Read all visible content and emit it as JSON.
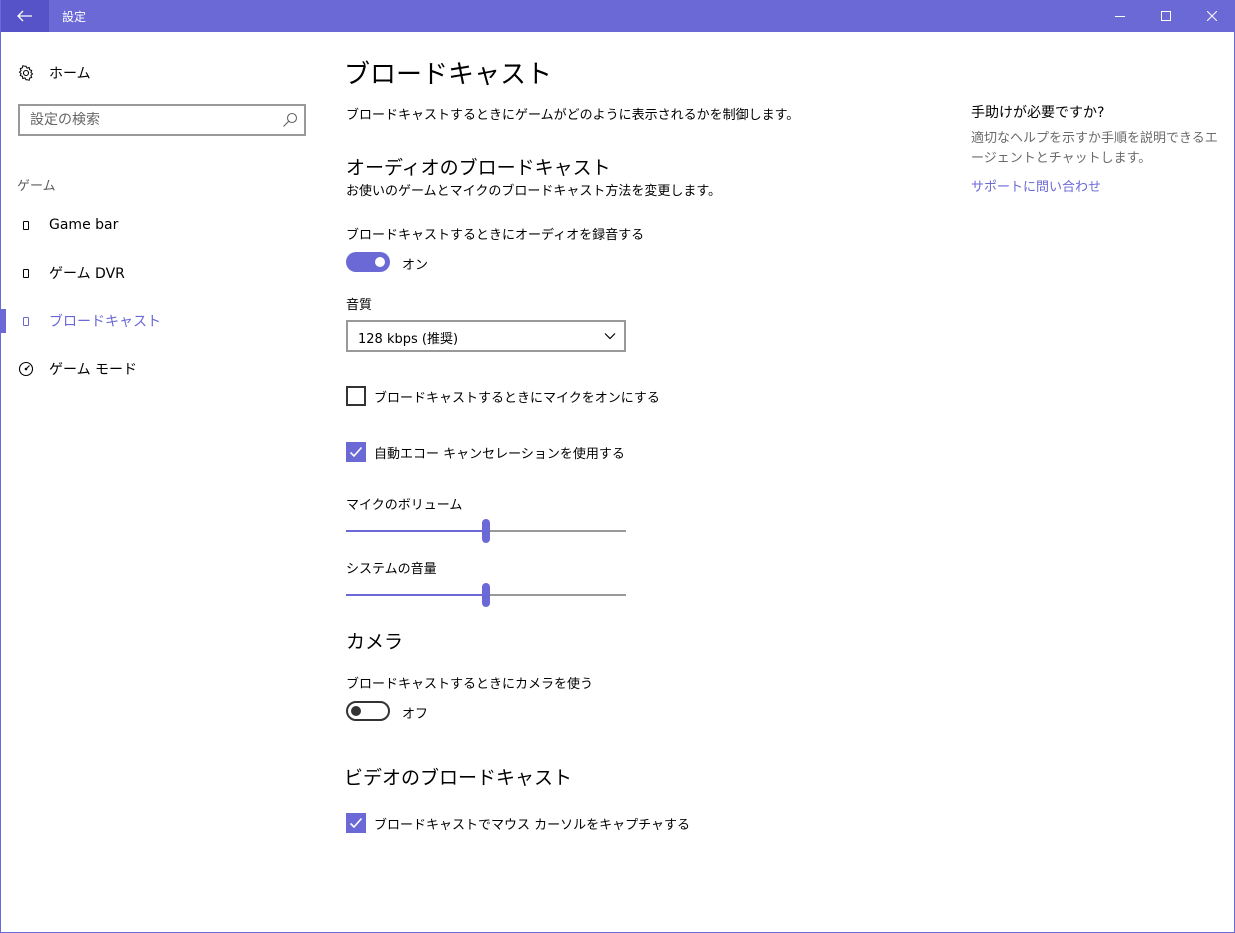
{
  "window": {
    "title": "設定",
    "accent_color": "#6b69d6"
  },
  "sidebar": {
    "home_label": "ホーム",
    "search_placeholder": "設定の検索",
    "group_header": "ゲーム",
    "items": [
      {
        "label": "Game bar",
        "selected": false
      },
      {
        "label": "ゲーム DVR",
        "selected": false
      },
      {
        "label": "ブロードキャスト",
        "selected": true
      },
      {
        "label": "ゲーム モード",
        "selected": false
      }
    ]
  },
  "main": {
    "page_title": "ブロードキャスト",
    "page_desc": "ブロードキャストするときにゲームがどのように表示されるかを制御します。",
    "audio": {
      "title": "オーディオのブロードキャスト",
      "desc": "お使いのゲームとマイクのブロードキャスト方法を変更します。",
      "record_audio_label": "ブロードキャストするときにオーディオを録音する",
      "record_audio_state": "オン",
      "quality_label": "音質",
      "quality_value": "128 kbps (推奨)",
      "mic_on_label": "ブロードキャストするときにマイクをオンにする",
      "mic_on_checked": false,
      "echo_cancel_label": "自動エコー キャンセレーションを使用する",
      "echo_cancel_checked": true,
      "mic_volume_label": "マイクのボリューム",
      "mic_volume_level": 0.5,
      "system_volume_label": "システムの音量",
      "system_volume_level": 0.5
    },
    "camera": {
      "title": "カメラ",
      "use_camera_label": "ブロードキャストするときにカメラを使う",
      "use_camera_state": "オフ"
    },
    "video": {
      "title": "ビデオのブロードキャスト",
      "capture_cursor_label": "ブロードキャストでマウス カーソルをキャプチャする",
      "capture_cursor_checked": true
    }
  },
  "help": {
    "title": "手助けが必要ですか?",
    "text": "適切なヘルプを示すか手順を説明できるエージェントとチャットします。",
    "link": "サポートに問い合わせ"
  }
}
